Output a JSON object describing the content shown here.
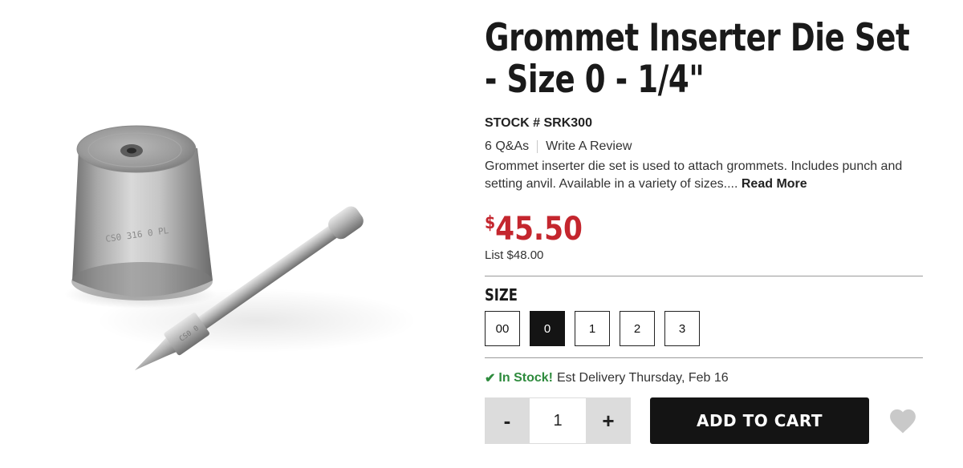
{
  "product": {
    "title_line1": "Grommet Inserter Die Set",
    "title_line2": "- Size 0 - 1/4\"",
    "stock_number": "STOCK # SRK300",
    "qa_link": "6 Q&As",
    "review_link": "Write A Review",
    "description": "Grommet inserter die set is used to attach grommets. Includes punch and setting anvil. Available in a variety of sizes....",
    "read_more": "Read More",
    "price_currency": "$",
    "price_amount": "45.50",
    "list_price": "List $48.00",
    "image_stamp_text": "CS0 316 0 PL",
    "image_punch_text": "CS0 0"
  },
  "size_selector": {
    "label": "SIZE",
    "options": [
      "00",
      "0",
      "1",
      "2",
      "3"
    ],
    "selected": "0"
  },
  "availability": {
    "icon": "check-icon",
    "status": "In Stock!",
    "delivery": "Est Delivery Thursday, Feb 16"
  },
  "cart": {
    "decrement_label": "-",
    "quantity": "1",
    "increment_label": "+",
    "add_label": "ADD TO CART",
    "wishlist_icon": "heart-icon"
  },
  "colors": {
    "price": "#c4262e",
    "in_stock": "#2e8b3d",
    "button": "#141414",
    "stepper": "#dcdcdc",
    "heart": "#c9c9c9"
  }
}
